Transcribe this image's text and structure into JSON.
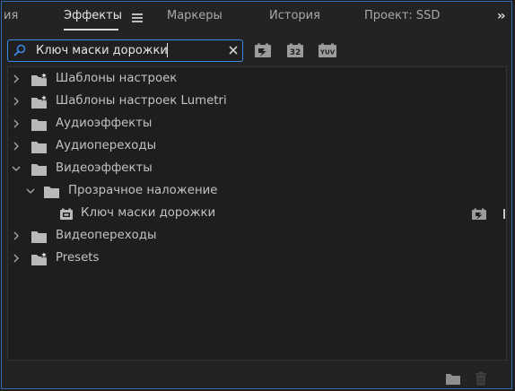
{
  "tabs": [
    {
      "label": "ия",
      "active": false
    },
    {
      "label": "Эффекты",
      "active": true
    },
    {
      "label": "Маркеры",
      "active": false
    },
    {
      "label": "История",
      "active": false
    },
    {
      "label": "Проект: SSD",
      "active": false
    }
  ],
  "search": {
    "value": "Ключ маски дорожки",
    "placeholder": ""
  },
  "filter_buttons": [
    {
      "icon": "accelerated-effects-icon",
      "label": ""
    },
    {
      "icon": "32-bit-color-icon",
      "label": "32"
    },
    {
      "icon": "yuv-effects-icon",
      "label": "YUV"
    }
  ],
  "tree": [
    {
      "label": "Шаблоны настроек",
      "level": 0,
      "expanded": false,
      "icon": "preset-bin-icon"
    },
    {
      "label": "Шаблоны настроек Lumetri",
      "level": 0,
      "expanded": false,
      "icon": "preset-bin-icon"
    },
    {
      "label": "Аудиоэффекты",
      "level": 0,
      "expanded": false,
      "icon": "folder-icon"
    },
    {
      "label": "Аудиопереходы",
      "level": 0,
      "expanded": false,
      "icon": "folder-icon"
    },
    {
      "label": "Видеоэффекты",
      "level": 0,
      "expanded": true,
      "icon": "folder-icon"
    },
    {
      "label": "Прозрачное наложение",
      "level": 1,
      "expanded": true,
      "icon": "folder-icon"
    },
    {
      "label": "Ключ маски дорожки",
      "level": 2,
      "expanded": null,
      "icon": "effect-icon",
      "accelerated": true
    },
    {
      "label": "Видеопереходы",
      "level": 0,
      "expanded": false,
      "icon": "folder-icon"
    },
    {
      "label": "Presets",
      "level": 0,
      "expanded": false,
      "icon": "preset-bin-icon"
    }
  ],
  "footer": {
    "new_bin_icon": "new-bin-icon",
    "delete_icon": "trash-icon"
  },
  "colors": {
    "accent": "#3b89e8",
    "panel_border": "#2f6db3",
    "background": "#232323"
  }
}
